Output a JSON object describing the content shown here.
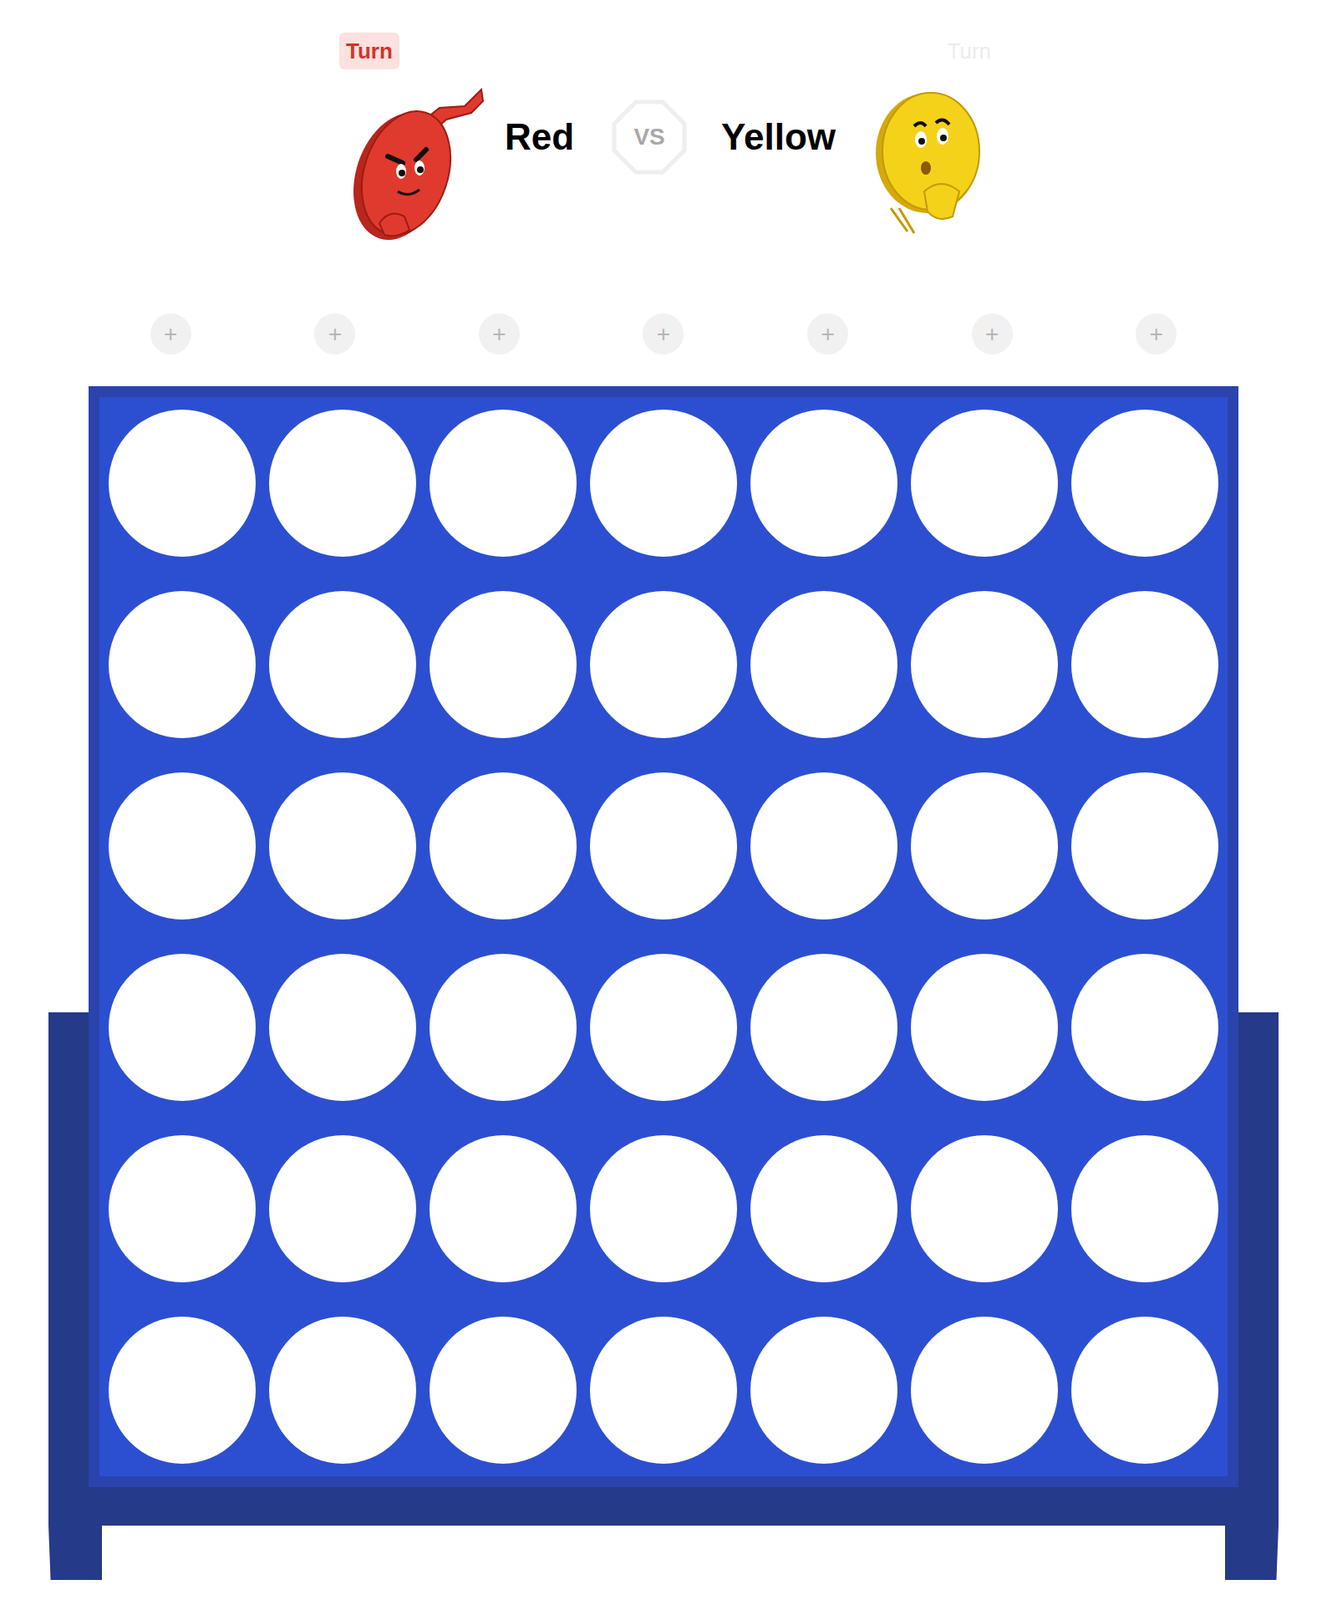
{
  "players": [
    {
      "name": "Red",
      "badge": "Turn",
      "selected": true,
      "color": "#e03a2e"
    },
    {
      "name": "Yellow",
      "badge": "Turn",
      "selected": false,
      "color": "#f4d21a"
    }
  ],
  "versus": "VS",
  "columns": [
    {
      "label": "+"
    },
    {
      "label": "+"
    },
    {
      "label": "+"
    },
    {
      "label": "+"
    },
    {
      "label": "+"
    },
    {
      "label": "+"
    },
    {
      "label": "+"
    }
  ],
  "board": {
    "rows": [
      [
        {
          "kind": "empty"
        },
        {
          "kind": "empty"
        },
        {
          "kind": "empty"
        },
        {
          "kind": "empty"
        },
        {
          "kind": "empty"
        },
        {
          "kind": "empty"
        },
        {
          "kind": "empty"
        }
      ],
      [
        {
          "kind": "empty"
        },
        {
          "kind": "empty"
        },
        {
          "kind": "empty"
        },
        {
          "kind": "empty"
        },
        {
          "kind": "empty"
        },
        {
          "kind": "empty"
        },
        {
          "kind": "empty"
        }
      ],
      [
        {
          "kind": "empty"
        },
        {
          "kind": "empty"
        },
        {
          "kind": "empty"
        },
        {
          "kind": "empty"
        },
        {
          "kind": "empty"
        },
        {
          "kind": "empty"
        },
        {
          "kind": "empty"
        }
      ],
      [
        {
          "kind": "empty"
        },
        {
          "kind": "empty"
        },
        {
          "kind": "empty"
        },
        {
          "kind": "empty"
        },
        {
          "kind": "empty"
        },
        {
          "kind": "empty"
        },
        {
          "kind": "empty"
        }
      ],
      [
        {
          "kind": "empty"
        },
        {
          "kind": "empty"
        },
        {
          "kind": "empty"
        },
        {
          "kind": "empty"
        },
        {
          "kind": "empty"
        },
        {
          "kind": "empty"
        },
        {
          "kind": "empty"
        }
      ],
      [
        {
          "kind": "empty"
        },
        {
          "kind": "empty"
        },
        {
          "kind": "empty"
        },
        {
          "kind": "empty"
        },
        {
          "kind": "empty"
        },
        {
          "kind": "empty"
        },
        {
          "kind": "empty"
        }
      ]
    ]
  }
}
